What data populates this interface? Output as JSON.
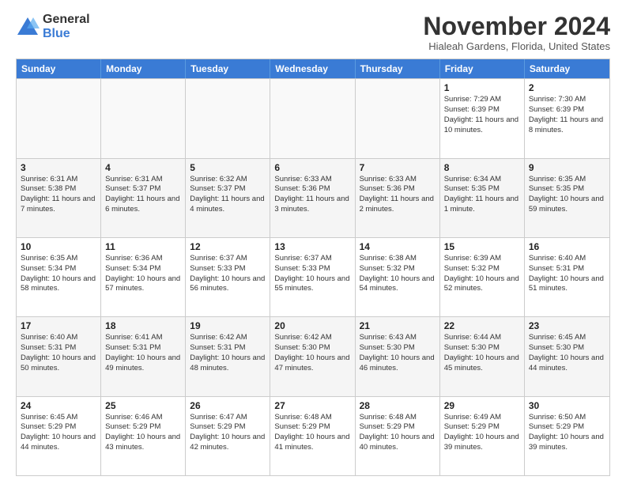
{
  "logo": {
    "general": "General",
    "blue": "Blue"
  },
  "header": {
    "month": "November 2024",
    "location": "Hialeah Gardens, Florida, United States"
  },
  "days": [
    "Sunday",
    "Monday",
    "Tuesday",
    "Wednesday",
    "Thursday",
    "Friday",
    "Saturday"
  ],
  "rows": [
    [
      {
        "day": "",
        "info": ""
      },
      {
        "day": "",
        "info": ""
      },
      {
        "day": "",
        "info": ""
      },
      {
        "day": "",
        "info": ""
      },
      {
        "day": "",
        "info": ""
      },
      {
        "day": "1",
        "info": "Sunrise: 7:29 AM\nSunset: 6:39 PM\nDaylight: 11 hours and 10 minutes."
      },
      {
        "day": "2",
        "info": "Sunrise: 7:30 AM\nSunset: 6:39 PM\nDaylight: 11 hours and 8 minutes."
      }
    ],
    [
      {
        "day": "3",
        "info": "Sunrise: 6:31 AM\nSunset: 5:38 PM\nDaylight: 11 hours and 7 minutes."
      },
      {
        "day": "4",
        "info": "Sunrise: 6:31 AM\nSunset: 5:37 PM\nDaylight: 11 hours and 6 minutes."
      },
      {
        "day": "5",
        "info": "Sunrise: 6:32 AM\nSunset: 5:37 PM\nDaylight: 11 hours and 4 minutes."
      },
      {
        "day": "6",
        "info": "Sunrise: 6:33 AM\nSunset: 5:36 PM\nDaylight: 11 hours and 3 minutes."
      },
      {
        "day": "7",
        "info": "Sunrise: 6:33 AM\nSunset: 5:36 PM\nDaylight: 11 hours and 2 minutes."
      },
      {
        "day": "8",
        "info": "Sunrise: 6:34 AM\nSunset: 5:35 PM\nDaylight: 11 hours and 1 minute."
      },
      {
        "day": "9",
        "info": "Sunrise: 6:35 AM\nSunset: 5:35 PM\nDaylight: 10 hours and 59 minutes."
      }
    ],
    [
      {
        "day": "10",
        "info": "Sunrise: 6:35 AM\nSunset: 5:34 PM\nDaylight: 10 hours and 58 minutes."
      },
      {
        "day": "11",
        "info": "Sunrise: 6:36 AM\nSunset: 5:34 PM\nDaylight: 10 hours and 57 minutes."
      },
      {
        "day": "12",
        "info": "Sunrise: 6:37 AM\nSunset: 5:33 PM\nDaylight: 10 hours and 56 minutes."
      },
      {
        "day": "13",
        "info": "Sunrise: 6:37 AM\nSunset: 5:33 PM\nDaylight: 10 hours and 55 minutes."
      },
      {
        "day": "14",
        "info": "Sunrise: 6:38 AM\nSunset: 5:32 PM\nDaylight: 10 hours and 54 minutes."
      },
      {
        "day": "15",
        "info": "Sunrise: 6:39 AM\nSunset: 5:32 PM\nDaylight: 10 hours and 52 minutes."
      },
      {
        "day": "16",
        "info": "Sunrise: 6:40 AM\nSunset: 5:31 PM\nDaylight: 10 hours and 51 minutes."
      }
    ],
    [
      {
        "day": "17",
        "info": "Sunrise: 6:40 AM\nSunset: 5:31 PM\nDaylight: 10 hours and 50 minutes."
      },
      {
        "day": "18",
        "info": "Sunrise: 6:41 AM\nSunset: 5:31 PM\nDaylight: 10 hours and 49 minutes."
      },
      {
        "day": "19",
        "info": "Sunrise: 6:42 AM\nSunset: 5:31 PM\nDaylight: 10 hours and 48 minutes."
      },
      {
        "day": "20",
        "info": "Sunrise: 6:42 AM\nSunset: 5:30 PM\nDaylight: 10 hours and 47 minutes."
      },
      {
        "day": "21",
        "info": "Sunrise: 6:43 AM\nSunset: 5:30 PM\nDaylight: 10 hours and 46 minutes."
      },
      {
        "day": "22",
        "info": "Sunrise: 6:44 AM\nSunset: 5:30 PM\nDaylight: 10 hours and 45 minutes."
      },
      {
        "day": "23",
        "info": "Sunrise: 6:45 AM\nSunset: 5:30 PM\nDaylight: 10 hours and 44 minutes."
      }
    ],
    [
      {
        "day": "24",
        "info": "Sunrise: 6:45 AM\nSunset: 5:29 PM\nDaylight: 10 hours and 44 minutes."
      },
      {
        "day": "25",
        "info": "Sunrise: 6:46 AM\nSunset: 5:29 PM\nDaylight: 10 hours and 43 minutes."
      },
      {
        "day": "26",
        "info": "Sunrise: 6:47 AM\nSunset: 5:29 PM\nDaylight: 10 hours and 42 minutes."
      },
      {
        "day": "27",
        "info": "Sunrise: 6:48 AM\nSunset: 5:29 PM\nDaylight: 10 hours and 41 minutes."
      },
      {
        "day": "28",
        "info": "Sunrise: 6:48 AM\nSunset: 5:29 PM\nDaylight: 10 hours and 40 minutes."
      },
      {
        "day": "29",
        "info": "Sunrise: 6:49 AM\nSunset: 5:29 PM\nDaylight: 10 hours and 39 minutes."
      },
      {
        "day": "30",
        "info": "Sunrise: 6:50 AM\nSunset: 5:29 PM\nDaylight: 10 hours and 39 minutes."
      }
    ]
  ]
}
